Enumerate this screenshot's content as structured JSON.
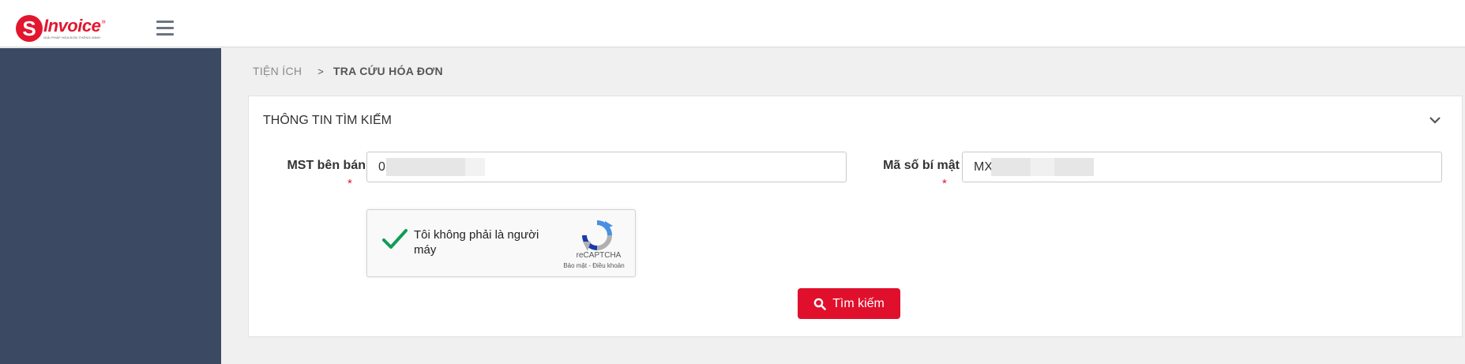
{
  "header": {
    "logo_initial": "S",
    "logo_word": "Invoice",
    "logo_tagline": "GIẢI PHÁP HÓA ĐƠN THÔNG MINH"
  },
  "breadcrumb": {
    "root": "TIỆN ÍCH",
    "separator": ">",
    "current": "TRA CỨU HÓA ĐƠN"
  },
  "panel": {
    "title": "THÔNG TIN TÌM KIẾM",
    "seller_tax_label": "MST bên bán",
    "seller_tax_value": "0",
    "secret_code_label": "Mã số bí mật",
    "secret_code_value": "MX",
    "required_mark": "*"
  },
  "recaptcha": {
    "label": "Tôi không phải là người máy",
    "brand": "reCAPTCHA",
    "links": "Bảo mật - Điều khoản",
    "checked": true
  },
  "search_button": {
    "label": "Tìm kiếm"
  },
  "colors": {
    "brand_red": "#e2162e",
    "sidebar": "#3b4a62",
    "check_green": "#0f9d58"
  }
}
